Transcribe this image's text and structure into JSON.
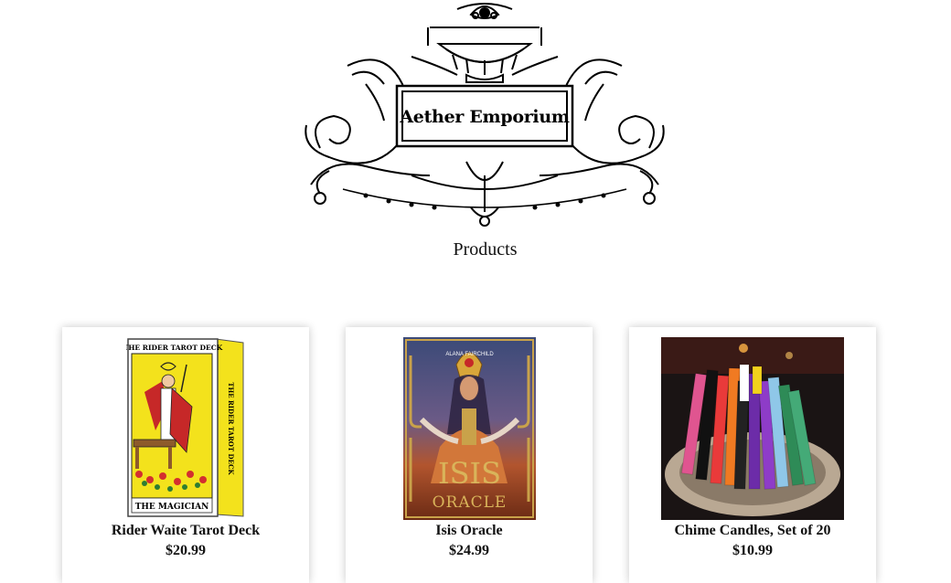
{
  "store": {
    "name": "Aether Emporium",
    "section_title": "Products"
  },
  "products": [
    {
      "name": "Rider Waite Tarot Deck",
      "price": "$20.99",
      "image": "rider-tarot-box-image",
      "box_label": "THE RIDER TAROT DECK",
      "card_label": "THE MAGICIAN"
    },
    {
      "name": "Isis Oracle",
      "price": "$24.99",
      "image": "isis-oracle-box-image",
      "author": "ALANA FAIRCHILD",
      "box_title_1": "ISIS",
      "box_title_2": "ORACLE"
    },
    {
      "name": "Chime Candles, Set of 20",
      "price": "$10.99",
      "image": "chime-candles-photo"
    }
  ],
  "colors": {
    "tarot_yellow": "#f3e21c",
    "isis_gold": "#c9a24a",
    "candle_bg": "#1a1414"
  }
}
